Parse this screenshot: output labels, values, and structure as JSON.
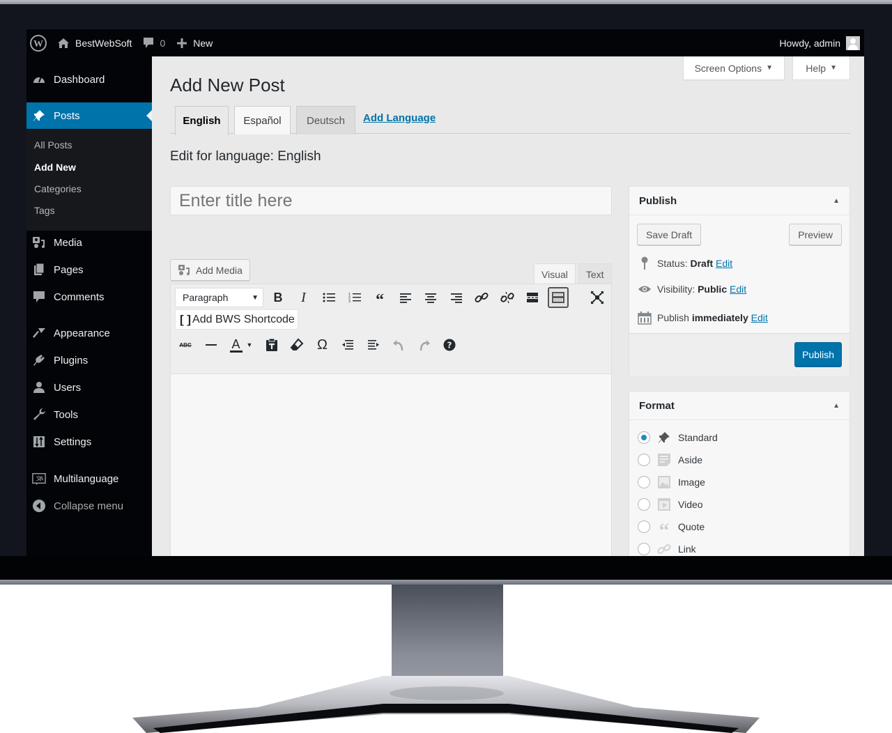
{
  "adminbar": {
    "site_name": "BestWebSoft",
    "comments_count": "0",
    "new_label": "New",
    "howdy": "Howdy, admin"
  },
  "sidebar": {
    "items": [
      {
        "label": "Dashboard",
        "icon": "dashboard-icon"
      },
      {
        "label": "Posts",
        "icon": "pin-icon",
        "active": true
      },
      {
        "label": "Media",
        "icon": "media-icon"
      },
      {
        "label": "Pages",
        "icon": "pages-icon"
      },
      {
        "label": "Comments",
        "icon": "comment-icon"
      },
      {
        "label": "Appearance",
        "icon": "paintbrush-icon"
      },
      {
        "label": "Plugins",
        "icon": "plugin-icon"
      },
      {
        "label": "Users",
        "icon": "user-icon"
      },
      {
        "label": "Tools",
        "icon": "wrench-icon"
      },
      {
        "label": "Settings",
        "icon": "settings-icon"
      },
      {
        "label": "Multilanguage",
        "icon": "translate-icon"
      },
      {
        "label": "Collapse menu",
        "icon": "collapse-icon"
      }
    ],
    "submenu": [
      {
        "label": "All Posts"
      },
      {
        "label": "Add New",
        "current": true
      },
      {
        "label": "Categories"
      },
      {
        "label": "Tags"
      }
    ]
  },
  "header": {
    "screen_options": "Screen Options",
    "help": "Help"
  },
  "main": {
    "page_title": "Add New Post",
    "lang_tabs": [
      {
        "label": "English",
        "active": true
      },
      {
        "label": "Español"
      },
      {
        "label": "Deutsch"
      }
    ],
    "add_language": "Add Language",
    "edit_for_language": "Edit for language: English",
    "title_placeholder": "Enter title here",
    "add_media": "Add Media",
    "editor_tabs": [
      {
        "label": "Visual",
        "active": true
      },
      {
        "label": "Text"
      }
    ],
    "format_select": "Paragraph",
    "bws_shortcode": "Add BWS Shortcode"
  },
  "publish_box": {
    "title": "Publish",
    "save_draft": "Save Draft",
    "preview": "Preview",
    "status_label": "Status:",
    "status_value": "Draft",
    "visibility_label": "Visibility:",
    "visibility_value": "Public",
    "publish_label": "Publish",
    "publish_value": "immediately",
    "edit_link": "Edit",
    "publish_button": "Publish"
  },
  "format_box": {
    "title": "Format",
    "options": [
      {
        "label": "Standard",
        "checked": true,
        "icon": "pin-icon"
      },
      {
        "label": "Aside",
        "icon": "aside-icon"
      },
      {
        "label": "Image",
        "icon": "image-icon"
      },
      {
        "label": "Video",
        "icon": "video-icon"
      },
      {
        "label": "Quote",
        "icon": "quote-icon"
      },
      {
        "label": "Link",
        "icon": "link-icon"
      }
    ]
  },
  "colors": {
    "accent": "#0073aa",
    "adminbar_bg": "#020408",
    "content_bg": "#e9e9e9"
  }
}
